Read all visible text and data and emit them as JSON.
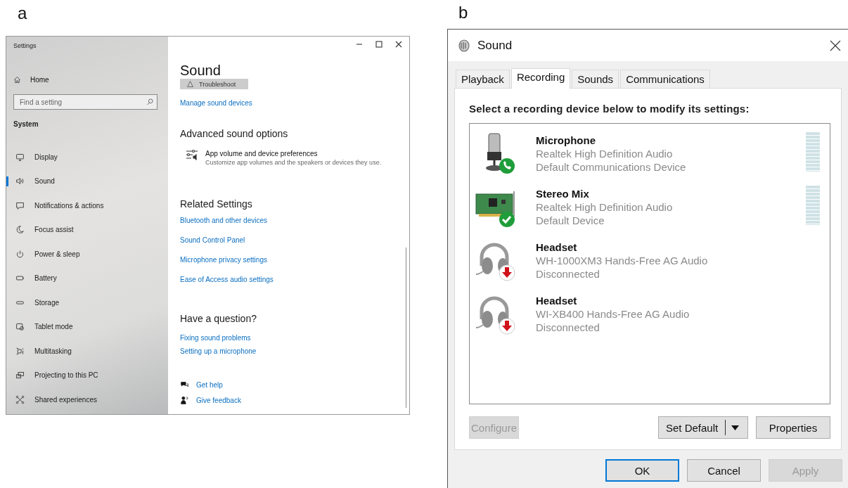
{
  "figure_labels": [
    "a",
    "b"
  ],
  "settings": {
    "title": "Settings",
    "home": "Home",
    "search": {
      "placeholder": "Find a setting"
    },
    "section": "System",
    "sidebar_items": [
      {
        "label": "Display",
        "selected": false
      },
      {
        "label": "Sound",
        "selected": true
      },
      {
        "label": "Notifications & actions",
        "selected": false
      },
      {
        "label": "Focus assist",
        "selected": false
      },
      {
        "label": "Power & sleep",
        "selected": false
      },
      {
        "label": "Battery",
        "selected": false
      },
      {
        "label": "Storage",
        "selected": false
      },
      {
        "label": "Tablet mode",
        "selected": false
      },
      {
        "label": "Multitasking",
        "selected": false
      },
      {
        "label": "Projecting to this PC",
        "selected": false
      },
      {
        "label": "Shared experiences",
        "selected": false
      }
    ],
    "heading": "Sound",
    "troubleshoot": "Troubleshoot",
    "manage_link": "Manage sound devices",
    "advanced": {
      "heading": "Advanced sound options",
      "item_title": "App volume and device preferences",
      "item_description": "Customize app volumes and the speakers or devices they use."
    },
    "related": {
      "heading": "Related Settings",
      "links": [
        "Bluetooth and other devices",
        "Sound Control Panel",
        "Microphone privacy settings",
        "Ease of Access audio settings"
      ]
    },
    "question": {
      "heading": "Have a question?",
      "links": [
        "Fixing sound problems",
        "Setting up a microphone"
      ]
    },
    "help_links": [
      {
        "kind": "help",
        "label": "Get help"
      },
      {
        "kind": "feedback",
        "label": "Give feedback"
      }
    ]
  },
  "sound_dialog": {
    "title": "Sound",
    "tabs": [
      {
        "label": "Playback",
        "selected": false
      },
      {
        "label": "Recording",
        "selected": true
      },
      {
        "label": "Sounds",
        "selected": false
      },
      {
        "label": "Communications",
        "selected": false
      }
    ],
    "instruction": "Select a recording device below to modify its settings:",
    "devices": [
      {
        "icon": {
          "kind": "microphone"
        },
        "badge": {
          "kind": "phone"
        },
        "name": "Microphone",
        "driver": "Realtek High Definition Audio",
        "status": "Default Communications Device",
        "meter": true
      },
      {
        "icon": {
          "kind": "card"
        },
        "badge": {
          "kind": "check"
        },
        "name": "Stereo Mix",
        "driver": "Realtek High Definition Audio",
        "status": "Default Device",
        "meter": true
      },
      {
        "icon": {
          "kind": "headset"
        },
        "badge": {
          "kind": "down"
        },
        "name": "Headset",
        "driver": "WH-1000XM3 Hands-Free AG Audio",
        "status": "Disconnected",
        "meter": false
      },
      {
        "icon": {
          "kind": "headset"
        },
        "badge": {
          "kind": "down"
        },
        "name": "Headset",
        "driver": "WI-XB400 Hands-Free AG Audio",
        "status": "Disconnected",
        "meter": false
      }
    ],
    "buttons": [
      {
        "kind": "plain",
        "label": "Configure",
        "disabled": true
      },
      {
        "kind": "split",
        "label": "Set Default",
        "disabled": false
      },
      {
        "kind": "plain",
        "label": "Properties",
        "disabled": false
      }
    ],
    "footer_buttons": [
      {
        "label": "OK",
        "default": true,
        "disabled": false
      },
      {
        "label": "Cancel",
        "default": false,
        "disabled": false
      },
      {
        "label": "Apply",
        "default": false,
        "disabled": true
      }
    ]
  }
}
